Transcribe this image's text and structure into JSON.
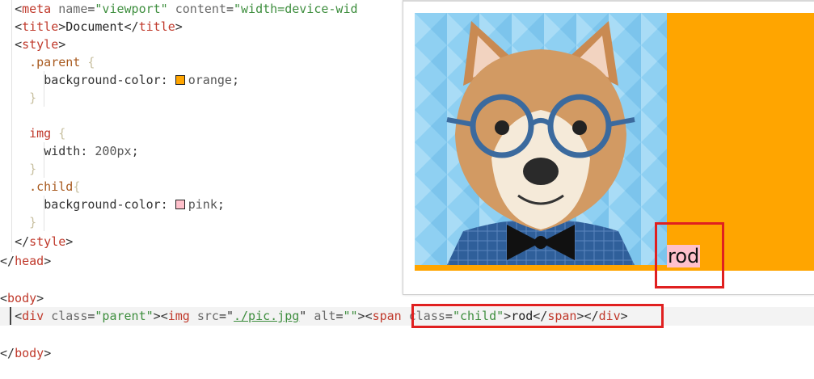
{
  "code": {
    "line1": {
      "indent": "  ",
      "open": "<",
      "tag": "meta",
      "sp1": " ",
      "attr1": "name",
      "eq1": "=",
      "val1": "\"viewport\"",
      "sp2": " ",
      "attr2": "content",
      "eq2": "=",
      "val2": "\"width=device-wid"
    },
    "line2": {
      "indent": "  ",
      "open": "<",
      "tag": "title",
      "close": ">",
      "text": "Document",
      "endopen": "</",
      "endtag": "title",
      "endclose": ">"
    },
    "line3": {
      "indent": "  ",
      "open": "<",
      "tag": "style",
      "close": ">"
    },
    "line4": {
      "indent": "    ",
      "selector": ".parent",
      "brace": " {"
    },
    "line5": {
      "indent": "      ",
      "prop": "background-color:",
      "value": "orange",
      "semi": ";"
    },
    "line6": {
      "indent": "    ",
      "brace": "}"
    },
    "line8": {
      "indent": "    ",
      "selector": "img",
      "brace": " {"
    },
    "line9": {
      "indent": "      ",
      "prop": "width:",
      "value": "200px",
      "semi": ";"
    },
    "line10": {
      "indent": "    ",
      "brace": "}"
    },
    "line11": {
      "indent": "    ",
      "selector": ".child",
      "brace": "{"
    },
    "line12": {
      "indent": "      ",
      "prop": "background-color:",
      "value": "pink",
      "semi": ";"
    },
    "line13": {
      "indent": "    ",
      "brace": "}"
    },
    "line14": {
      "indent": "  ",
      "open": "</",
      "tag": "style",
      "close": ">"
    },
    "line15": {
      "open": "</",
      "tag": "head",
      "close": ">"
    },
    "line17": {
      "open": "<",
      "tag": "body",
      "close": ">"
    },
    "line18": {
      "indent": "  ",
      "open": "<",
      "tag": "div",
      "sp1": " ",
      "attr1": "class",
      "eq1": "=",
      "val1": "\"parent\"",
      "close1": ">",
      "open2": "<",
      "tag2": "img",
      "sp2": " ",
      "attr2": "src",
      "eq2": "=\"",
      "link": "./pic.jpg",
      "q2": "\"",
      "sp3": " ",
      "attr3": "alt",
      "eq3": "=",
      "val3": "\"\"",
      "close2": ">",
      "open3": "<",
      "tag3": "span",
      "sp4": " ",
      "attr4": "class",
      "eq4": "=",
      "val4": "\"child\"",
      "close3": ">",
      "text": "rod",
      "endopen1": "</",
      "endtag1": "span",
      "endclose1": ">",
      "endopen2": "</",
      "endtag2": "div",
      "endclose2": ">"
    },
    "line20": {
      "open": "</",
      "tag": "body",
      "close": ">"
    }
  },
  "colors": {
    "orange": "#ffa500",
    "pink": "#ffc0cb",
    "highlight": "#e02020"
  },
  "preview": {
    "child_text": "rod",
    "image_alt": "shiba-dog-with-glasses-illustration"
  }
}
